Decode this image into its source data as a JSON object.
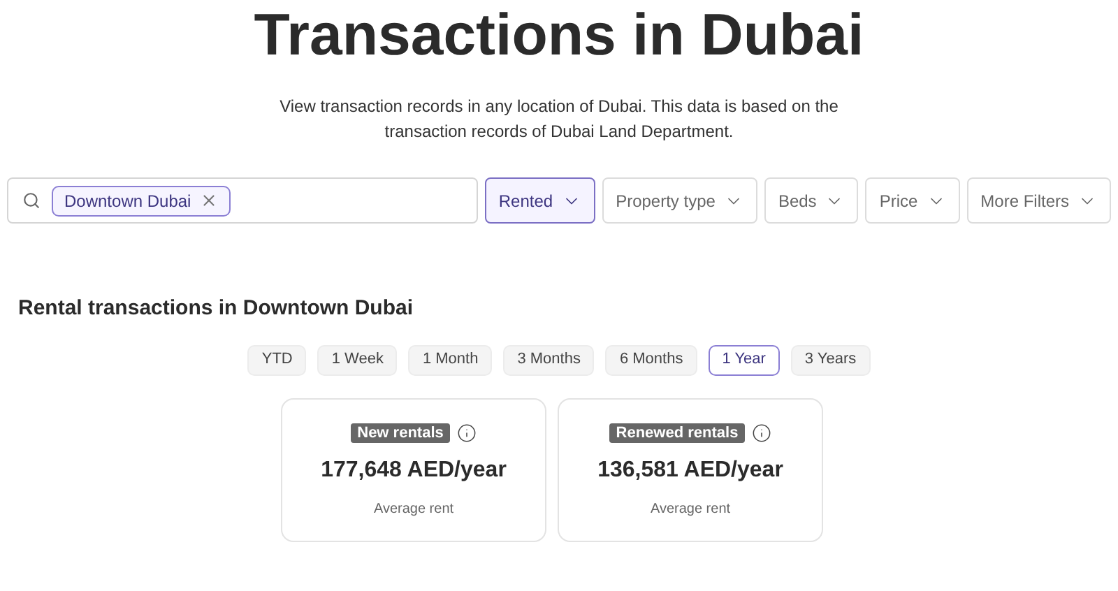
{
  "title": "Transactions in Dubai",
  "description": "View transaction records in any location of Dubai. This data is based on the transaction records of Dubai Land Department.",
  "search": {
    "chips": [
      {
        "label": "Downtown Dubai"
      }
    ]
  },
  "filters": [
    {
      "label": "Rented",
      "selected": true
    },
    {
      "label": "Property type",
      "selected": false
    },
    {
      "label": "Beds",
      "selected": false
    },
    {
      "label": "Price",
      "selected": false
    },
    {
      "label": "More Filters",
      "selected": false
    }
  ],
  "section_title": "Rental transactions in Downtown Dubai",
  "periods": [
    {
      "label": "YTD",
      "selected": false
    },
    {
      "label": "1 Week",
      "selected": false
    },
    {
      "label": "1 Month",
      "selected": false
    },
    {
      "label": "3 Months",
      "selected": false
    },
    {
      "label": "6 Months",
      "selected": false
    },
    {
      "label": "1 Year",
      "selected": true
    },
    {
      "label": "3 Years",
      "selected": false
    }
  ],
  "cards": [
    {
      "tag": "New rentals",
      "value": "177,648 AED/year",
      "caption": "Average rent"
    },
    {
      "tag": "Renewed rentals",
      "value": "136,581 AED/year",
      "caption": "Average rent"
    }
  ]
}
